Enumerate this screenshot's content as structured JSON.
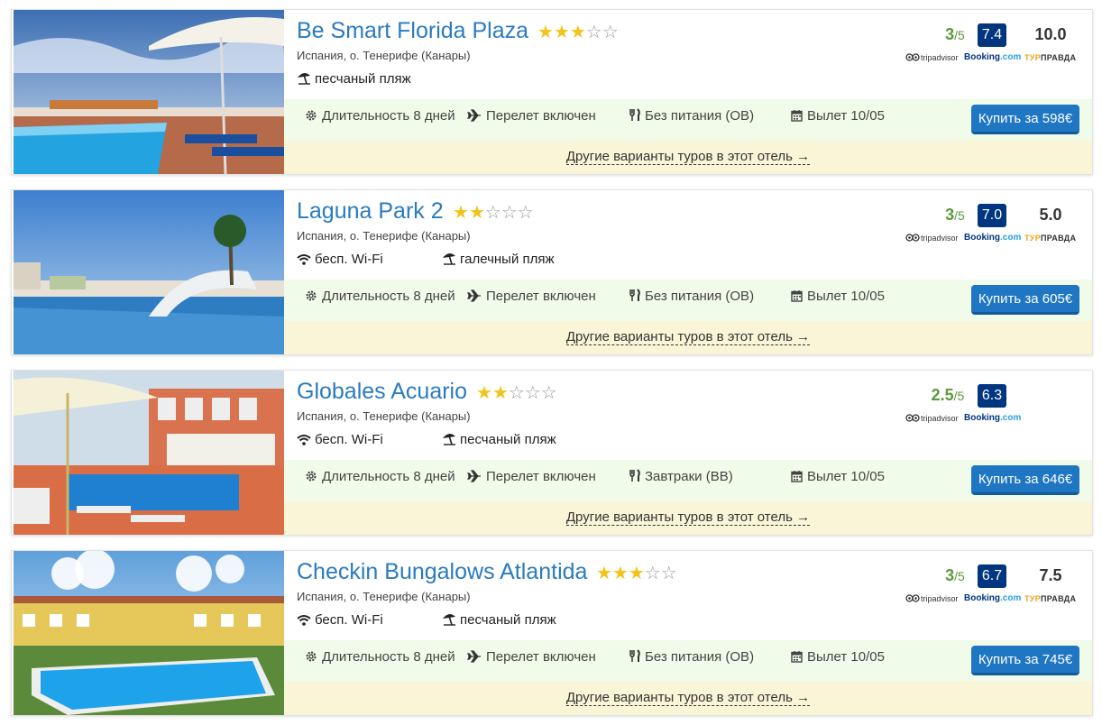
{
  "buy_prefix": "Купить за",
  "other_tours": "Другие варианты туров в этот отель →",
  "logos": {
    "tripadvisor": "tripadvisor",
    "booking": "Booking",
    "booking_com": ".com",
    "turpravda_y": "ТУР",
    "turpravda_rest": "ПРАВДА"
  },
  "icons": {
    "beach": "beach-umbrella-icon",
    "wifi": "wifi-icon",
    "duration": "gear-icon",
    "flight": "airplane-icon",
    "meal": "cutlery-icon",
    "departure": "calendar-icon"
  },
  "colors": {
    "title": "#2a7bbf",
    "button": "#1f77c4",
    "info_bar": "#f0fbe9",
    "other_bar": "#fbf5d8",
    "booking_badge": "#003580",
    "tripadvisor": "#5a9a3a",
    "star": "#f0c419"
  },
  "hotels": [
    {
      "name": "Be Smart Florida Plaza",
      "stars": 3,
      "location": "Испания, о. Тенерифе (Канары)",
      "amenities": [
        {
          "icon": "beach-umbrella-icon",
          "label": "песчаный пляж"
        }
      ],
      "duration": "Длительность 8 дней",
      "flight": "Перелет включен",
      "meal": "Без питания (ОВ)",
      "departure": "Вылет 10/05",
      "buy": "Купить за 598€",
      "tripadvisor": "3",
      "tripadvisor_den": "/5",
      "booking": "7.4",
      "turpravda": "10.0"
    },
    {
      "name": "Laguna Park 2",
      "stars": 2,
      "location": "Испания, о. Тенерифе (Канары)",
      "amenities": [
        {
          "icon": "wifi-icon",
          "label": "бесп. Wi-Fi"
        },
        {
          "icon": "beach-umbrella-icon",
          "label": "галечный пляж"
        }
      ],
      "duration": "Длительность 8 дней",
      "flight": "Перелет включен",
      "meal": "Без питания (ОВ)",
      "departure": "Вылет 10/05",
      "buy": "Купить за 605€",
      "tripadvisor": "3",
      "tripadvisor_den": "/5",
      "booking": "7.0",
      "turpravda": "5.0"
    },
    {
      "name": "Globales Acuario",
      "stars": 2,
      "location": "Испания, о. Тенерифе (Канары)",
      "amenities": [
        {
          "icon": "wifi-icon",
          "label": "бесп. Wi-Fi"
        },
        {
          "icon": "beach-umbrella-icon",
          "label": "песчаный пляж"
        }
      ],
      "duration": "Длительность 8 дней",
      "flight": "Перелет включен",
      "meal": "Завтраки (BB)",
      "departure": "Вылет 10/05",
      "buy": "Купить за 646€",
      "tripadvisor": "2.5",
      "tripadvisor_den": "/5",
      "booking": "6.3",
      "turpravda": ""
    },
    {
      "name": "Checkin Bungalows Atlantida",
      "stars": 3,
      "location": "Испания, о. Тенерифе (Канары)",
      "amenities": [
        {
          "icon": "wifi-icon",
          "label": "бесп. Wi-Fi"
        },
        {
          "icon": "beach-umbrella-icon",
          "label": "песчаный пляж"
        }
      ],
      "duration": "Длительность 8 дней",
      "flight": "Перелет включен",
      "meal": "Без питания (ОВ)",
      "departure": "Вылет 10/05",
      "buy": "Купить за 745€",
      "tripadvisor": "3",
      "tripadvisor_den": "/5",
      "booking": "6.7",
      "turpravda": "7.5"
    }
  ]
}
